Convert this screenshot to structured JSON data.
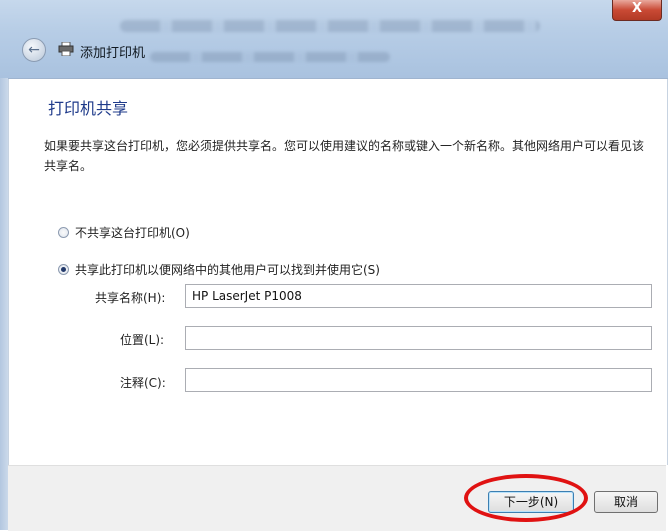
{
  "window": {
    "title": "添加打印机",
    "close_label": "X"
  },
  "page": {
    "heading": "打印机共享",
    "description": "如果要共享这台打印机，您必须提供共享名。您可以使用建议的名称或键入一个新名称。其他网络用户可以看见该共享名。"
  },
  "options": {
    "no_share": "不共享这台打印机(O)",
    "share": "共享此打印机以便网络中的其他用户可以找到并使用它(S)",
    "selected": "share"
  },
  "fields": {
    "share_name_label": "共享名称(H):",
    "share_name_value": "HP LaserJet P1008",
    "location_label": "位置(L):",
    "location_value": "",
    "comment_label": "注释(C):",
    "comment_value": ""
  },
  "buttons": {
    "next": "下一步(N)",
    "cancel": "取消"
  },
  "colors": {
    "heading": "#1e3a8a",
    "highlight": "#e01212",
    "close": "#c94a35"
  }
}
